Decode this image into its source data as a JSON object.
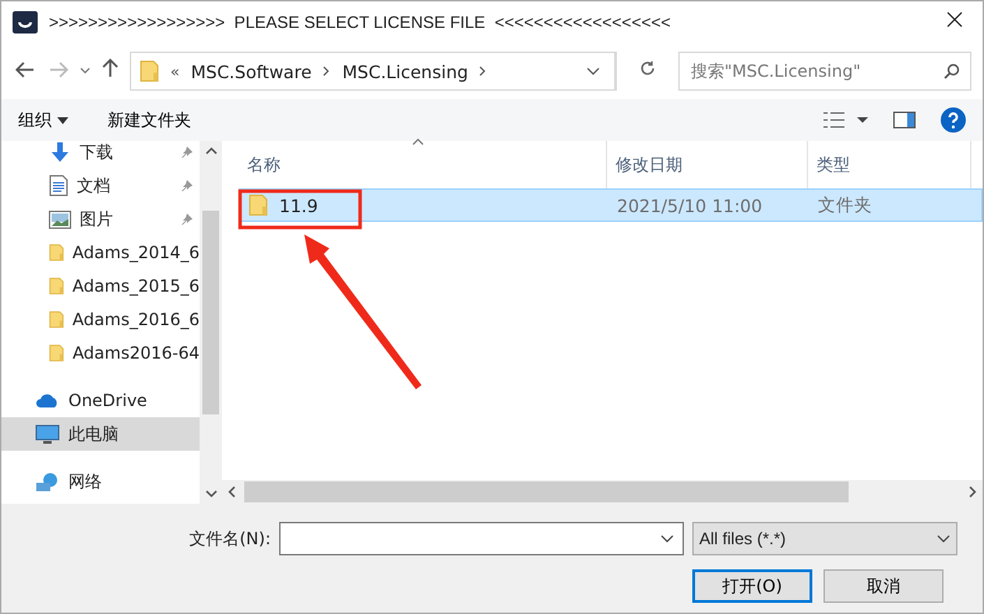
{
  "window": {
    "title": ">>>>>>>>>>>>>>>>>>  PLEASE SELECT LICENSE FILE  <<<<<<<<<<<<<<<<<<"
  },
  "address": {
    "overflow": "«",
    "crumbs": [
      "MSC.Software",
      "MSC.Licensing"
    ]
  },
  "search": {
    "placeholder": "搜索\"MSC.Licensing\""
  },
  "toolbar": {
    "organize": "组织",
    "new_folder": "新建文件夹"
  },
  "sidebar": {
    "items": [
      {
        "label": "下载",
        "kind": "download",
        "pinned": true,
        "selected": false
      },
      {
        "label": "文档",
        "kind": "document",
        "pinned": true,
        "selected": false
      },
      {
        "label": "图片",
        "kind": "pictures",
        "pinned": true,
        "selected": false
      },
      {
        "label": "Adams_2014_6",
        "kind": "folder",
        "pinned": false,
        "selected": false
      },
      {
        "label": "Adams_2015_6",
        "kind": "folder",
        "pinned": false,
        "selected": false
      },
      {
        "label": "Adams_2016_6",
        "kind": "folder",
        "pinned": false,
        "selected": false
      },
      {
        "label": "Adams2016-64",
        "kind": "folder",
        "pinned": false,
        "selected": false
      },
      {
        "label": "OneDrive",
        "kind": "cloud",
        "pinned": false,
        "selected": false
      },
      {
        "label": "此电脑",
        "kind": "computer",
        "pinned": false,
        "selected": true
      },
      {
        "label": "网络",
        "kind": "network",
        "pinned": false,
        "selected": false
      }
    ]
  },
  "table": {
    "columns": [
      "名称",
      "修改日期",
      "类型"
    ],
    "rows": [
      {
        "name": "11.9",
        "date": "2021/5/10 11:00",
        "type": "文件夹",
        "selected": true
      }
    ]
  },
  "footer": {
    "filename_label": "文件名(N):",
    "filter": "All files (*.*)",
    "open": "打开(O)",
    "cancel": "取消"
  }
}
